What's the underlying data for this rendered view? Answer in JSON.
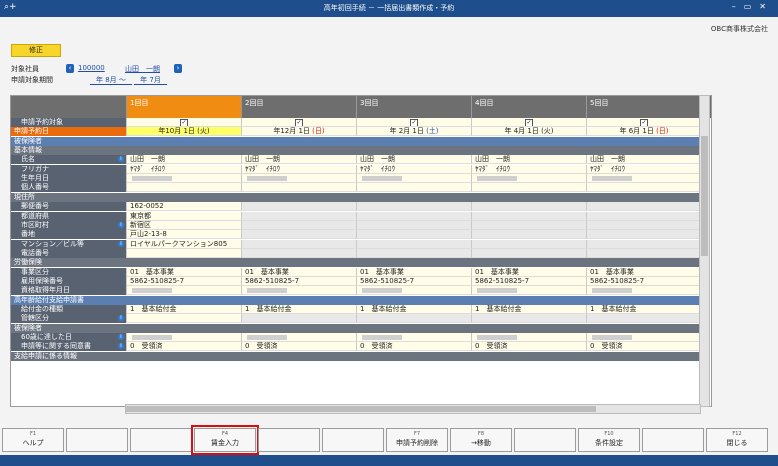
{
  "window": {
    "title": "高年初回手続 － 一括届出書類作成・予約",
    "company": "OBC商事株式会社"
  },
  "mode_badge": "修正",
  "employee": {
    "label": "対象社員",
    "code": "100000",
    "name": "山田　一朗"
  },
  "period": {
    "label": "申請対象期間",
    "from": "年 8月 ～",
    "to": "年 7月"
  },
  "columns": [
    "1回目",
    "2回目",
    "3回目",
    "4回目",
    "5回目"
  ],
  "rows": [
    {
      "type": "item",
      "label": "申請予約対象",
      "cells": [
        {
          "check": "✓"
        },
        {
          "check": "✓"
        },
        {
          "check": "✓"
        },
        {
          "check": "✓"
        },
        {
          "check": "✓"
        }
      ]
    },
    {
      "type": "orange",
      "label": "申請予約日",
      "cells": [
        {
          "date": "年10月 1日",
          "dow": "(火)",
          "cls": ""
        },
        {
          "date": "年12月 1日",
          "dow": "(日)",
          "cls": "sun"
        },
        {
          "date": "年 2月 1日",
          "dow": "(土)",
          "cls": "sat"
        },
        {
          "date": "年 4月 1日",
          "dow": "(火)",
          "cls": ""
        },
        {
          "date": "年 6月 1日",
          "dow": "(日)",
          "cls": "sun"
        }
      ]
    },
    {
      "type": "blue",
      "label": "被保険者"
    },
    {
      "type": "section",
      "label": "基本情報"
    },
    {
      "type": "item",
      "label": "氏名",
      "info": true,
      "cells": [
        "山田　一朗",
        "山田　一朗",
        "山田　一朗",
        "山田　一朗",
        "山田　一朗"
      ]
    },
    {
      "type": "item",
      "label": "フリガナ",
      "cells": [
        "ﾔﾏﾀﾞ　ｲﾁﾛｳ",
        "ﾔﾏﾀﾞ　ｲﾁﾛｳ",
        "ﾔﾏﾀﾞ　ｲﾁﾛｳ",
        "ﾔﾏﾀﾞ　ｲﾁﾛｳ",
        "ﾔﾏﾀﾞ　ｲﾁﾛｳ"
      ]
    },
    {
      "type": "item",
      "label": "生年月日",
      "cells": [
        "",
        "",
        "",
        "",
        ""
      ],
      "blur": true
    },
    {
      "type": "item",
      "label": "個人番号",
      "cells": [
        "",
        "",
        "",
        "",
        ""
      ]
    },
    {
      "type": "section",
      "label": "現住所"
    },
    {
      "type": "item",
      "label": "郵便番号",
      "cells": [
        "162-0052",
        "",
        "",
        "",
        ""
      ],
      "grey": true
    },
    {
      "type": "item",
      "label": "都道府県",
      "cells": [
        "東京都",
        "",
        "",
        "",
        ""
      ],
      "grey": true
    },
    {
      "type": "item",
      "label": "市区町村",
      "info": true,
      "cells": [
        "新宿区",
        "",
        "",
        "",
        ""
      ],
      "grey": true
    },
    {
      "type": "item",
      "label": "番地",
      "cells": [
        "戸山2-13-8",
        "",
        "",
        "",
        ""
      ],
      "grey": true
    },
    {
      "type": "item",
      "label": "マンション／ビル等",
      "info": true,
      "cells": [
        "ロイヤルパークマンション805",
        "",
        "",
        "",
        ""
      ],
      "grey": true
    },
    {
      "type": "item",
      "label": "電話番号",
      "cells": [
        "",
        "",
        "",
        "",
        ""
      ],
      "grey": true
    },
    {
      "type": "section",
      "label": "労働保険"
    },
    {
      "type": "item",
      "label": "事業区分",
      "cells": [
        "01　基本事業",
        "01　基本事業",
        "01　基本事業",
        "01　基本事業",
        "01　基本事業"
      ]
    },
    {
      "type": "item",
      "label": "雇用保険番号",
      "cells": [
        "5862-510825-7",
        "5862-510825-7",
        "5862-510825-7",
        "5862-510825-7",
        "5862-510825-7"
      ]
    },
    {
      "type": "item",
      "label": "資格取得年月日",
      "cells": [
        "",
        "",
        "",
        "",
        ""
      ],
      "blur": true
    },
    {
      "type": "blue",
      "label": "高年齢給付支給申請書"
    },
    {
      "type": "item",
      "label": "給付金の種類",
      "cells": [
        "1　基本給付金",
        "1　基本給付金",
        "1　基本給付金",
        "1　基本給付金",
        "1　基本給付金"
      ]
    },
    {
      "type": "item",
      "label": "管轄区分",
      "info": true,
      "cells": [
        "",
        "",
        "",
        "",
        ""
      ],
      "grey": true
    },
    {
      "type": "section",
      "label": "被保険者"
    },
    {
      "type": "item",
      "label": "60歳に達した日",
      "info": true,
      "cells": [
        "",
        "",
        "",
        "",
        ""
      ],
      "blur": true
    },
    {
      "type": "item",
      "label": "申請等に関する同意書",
      "info": true,
      "cells": [
        "0　受領済",
        "0　受領済",
        "0　受領済",
        "0　受領済",
        "0　受領済"
      ]
    },
    {
      "type": "section",
      "label": "支給申請に係る情報"
    }
  ],
  "fkeys": [
    {
      "key": "F1",
      "label": "ヘルプ"
    },
    {
      "key": "",
      "label": ""
    },
    {
      "key": "",
      "label": ""
    },
    {
      "key": "F4",
      "label": "賃金入力",
      "highlight": true
    },
    {
      "key": "",
      "label": ""
    },
    {
      "key": "",
      "label": ""
    },
    {
      "key": "F7",
      "label": "申請予約削除"
    },
    {
      "key": "F8",
      "label": "→移動"
    },
    {
      "key": "",
      "label": ""
    },
    {
      "key": "F10",
      "label": "条件設定"
    },
    {
      "key": "",
      "label": ""
    },
    {
      "key": "F12",
      "label": "閉じる"
    }
  ]
}
